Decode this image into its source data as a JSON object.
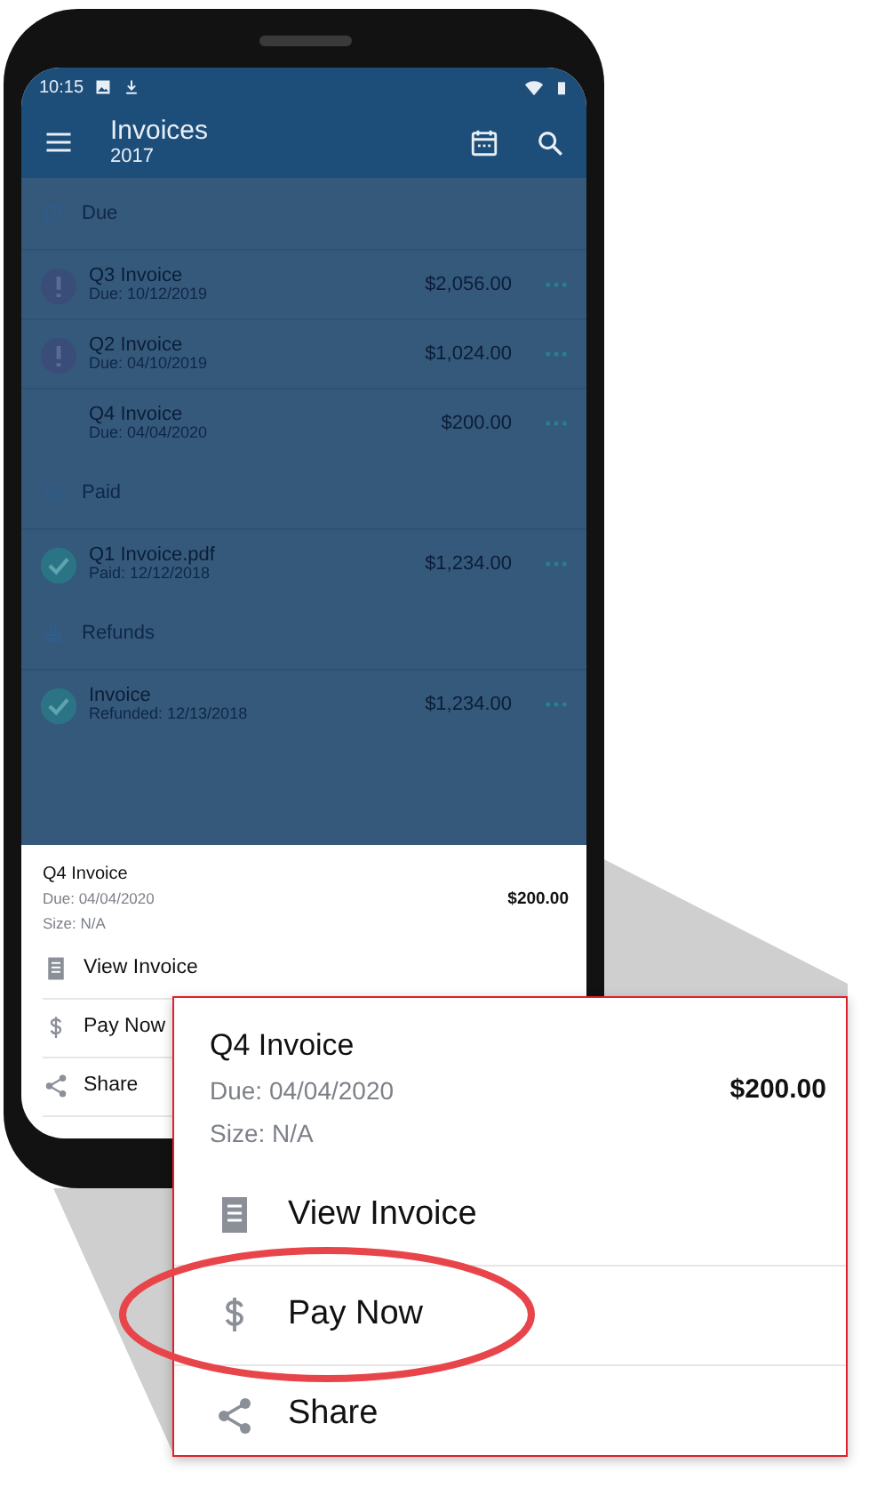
{
  "status_bar": {
    "time": "10:15"
  },
  "app_bar": {
    "title": "Invoices",
    "subtitle": "2017"
  },
  "sections": [
    {
      "kind": "due",
      "title": "Due",
      "items": [
        {
          "kind": "overdue",
          "name": "Q3 Invoice",
          "detail": "Due: 10/12/2019",
          "amount": "$2,056.00"
        },
        {
          "kind": "overdue",
          "name": "Q2 Invoice",
          "detail": "Due: 04/10/2019",
          "amount": "$1,024.00"
        },
        {
          "kind": "plain",
          "name": "Q4 Invoice",
          "detail": "Due: 04/04/2020",
          "amount": "$200.00"
        }
      ]
    },
    {
      "kind": "paid",
      "title": "Paid",
      "items": [
        {
          "kind": "done",
          "name": "Q1 Invoice.pdf",
          "detail": "Paid: 12/12/2018",
          "amount": "$1,234.00"
        }
      ]
    },
    {
      "kind": "refunds",
      "title": "Refunds",
      "items": [
        {
          "kind": "done",
          "name": "Invoice",
          "detail": "Refunded: 12/13/2018",
          "amount": "$1,234.00"
        }
      ]
    }
  ],
  "bottom_sheet": {
    "title": "Q4 Invoice",
    "due": "Due: 04/04/2020",
    "size": "Size: N/A",
    "amount": "$200.00",
    "actions": [
      {
        "kind": "view",
        "label": "View Invoice"
      },
      {
        "kind": "pay",
        "label": "Pay Now"
      },
      {
        "kind": "share",
        "label": "Share"
      }
    ]
  },
  "callout": {
    "title": "Q4 Invoice",
    "due": "Due: 04/04/2020",
    "size": "Size: N/A",
    "amount": "$200.00",
    "actions": [
      {
        "kind": "view",
        "label": "View Invoice",
        "circled": false
      },
      {
        "kind": "pay",
        "label": "Pay Now",
        "circled": true
      },
      {
        "kind": "share",
        "label": "Share",
        "circled": false
      }
    ]
  }
}
